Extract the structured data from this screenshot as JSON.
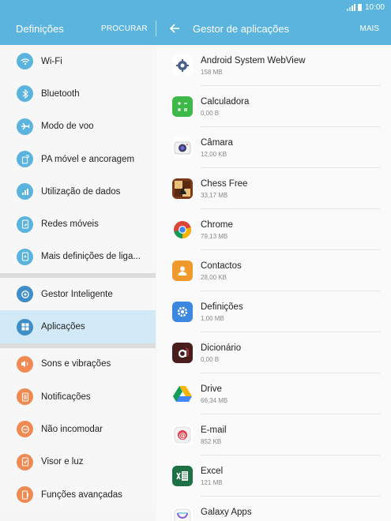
{
  "status": {
    "time": "10:00"
  },
  "header": {
    "left_title": "Definições",
    "search_label": "PROCURAR",
    "right_title": "Gestor de aplicações",
    "more_label": "MAIS"
  },
  "sidebar": {
    "items": [
      {
        "label": "Wi-Fi",
        "icon": "wifi-icon",
        "color": "#5bb4dd"
      },
      {
        "label": "Bluetooth",
        "icon": "bluetooth-icon",
        "color": "#5bb4dd"
      },
      {
        "label": "Modo de voo",
        "icon": "airplane-icon",
        "color": "#5bb4dd"
      },
      {
        "label": "PA móvel e ancoragem",
        "icon": "hotspot-icon",
        "color": "#5bb4dd"
      },
      {
        "label": "Utilização de dados",
        "icon": "data-usage-icon",
        "color": "#5bb4dd"
      },
      {
        "label": "Redes móveis",
        "icon": "mobile-networks-icon",
        "color": "#5bb4dd"
      },
      {
        "label": "Mais definições de liga...",
        "icon": "more-connections-icon",
        "color": "#5bb4dd"
      },
      {
        "label": "Gestor Inteligente",
        "icon": "smart-manager-icon",
        "color": "#3f8ec7"
      },
      {
        "label": "Aplicações",
        "icon": "apps-icon",
        "color": "#3f8ec7"
      },
      {
        "label": "Sons e vibrações",
        "icon": "sound-icon",
        "color": "#ef8a53"
      },
      {
        "label": "Notificações",
        "icon": "notifications-icon",
        "color": "#ef8a53"
      },
      {
        "label": "Não incomodar",
        "icon": "do-not-disturb-icon",
        "color": "#ef8a53"
      },
      {
        "label": "Visor e luz",
        "icon": "display-icon",
        "color": "#ef8a53"
      },
      {
        "label": "Funções avançadas",
        "icon": "advanced-features-icon",
        "color": "#ef8a53"
      }
    ],
    "selected": "Aplicações"
  },
  "apps": [
    {
      "name": "Android System WebView",
      "size": "158 MB",
      "icon": "webview-icon"
    },
    {
      "name": "Calculadora",
      "size": "0,00 B",
      "icon": "calculator-icon"
    },
    {
      "name": "Câmara",
      "size": "12,00 KB",
      "icon": "camera-icon"
    },
    {
      "name": "Chess Free",
      "size": "33,17 MB",
      "icon": "chess-icon"
    },
    {
      "name": "Chrome",
      "size": "79,13 MB",
      "icon": "chrome-icon"
    },
    {
      "name": "Contactos",
      "size": "28,00 KB",
      "icon": "contacts-icon"
    },
    {
      "name": "Definições",
      "size": "1,00 MB",
      "icon": "settings-icon"
    },
    {
      "name": "Dicionário",
      "size": "0,00 B",
      "icon": "dictionary-icon"
    },
    {
      "name": "Drive",
      "size": "66,34 MB",
      "icon": "drive-icon"
    },
    {
      "name": "E-mail",
      "size": "852 KB",
      "icon": "email-icon"
    },
    {
      "name": "Excel",
      "size": "121 MB",
      "icon": "excel-icon"
    },
    {
      "name": "Galaxy Apps",
      "size": "",
      "icon": "galaxy-apps-icon"
    }
  ],
  "colors": {
    "header": "#5bb4dd",
    "selected_row": "#d2eaf7"
  }
}
